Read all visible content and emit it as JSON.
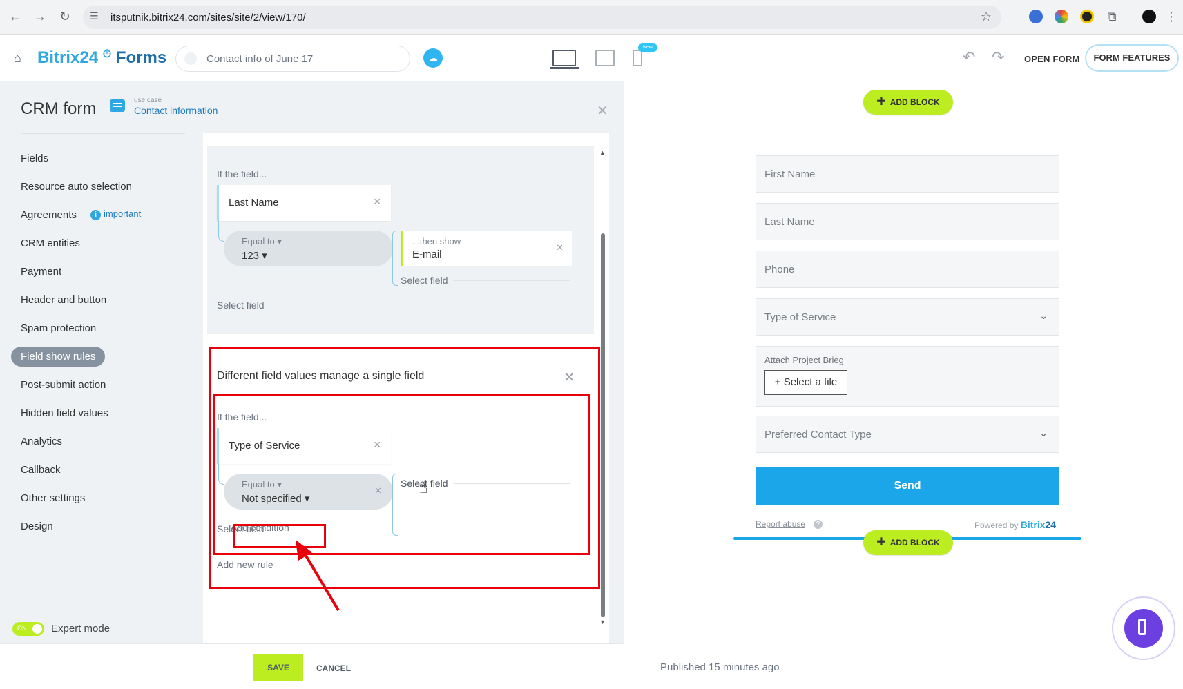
{
  "browser": {
    "url": "itsputnik.bitrix24.com/sites/site/2/view/170/"
  },
  "header": {
    "brand_main": "Bitrix24",
    "brand_sub": "Forms",
    "form_title": "Contact info of June 17",
    "new_badge": "New",
    "open_form": "OPEN FORM",
    "form_features": "FORM FEATURES"
  },
  "panel": {
    "title": "CRM form",
    "usecase_label": "use case",
    "usecase_link": "Contact information",
    "menu": [
      "Fields",
      "Resource auto selection",
      "Agreements",
      "CRM entities",
      "Payment",
      "Header and button",
      "Spam protection",
      "Field show rules",
      "Post-submit action",
      "Hidden field values",
      "Analytics",
      "Callback",
      "Other settings",
      "Design"
    ],
    "active_menu": "Field show rules",
    "important": "important",
    "expert_mode": "Expert mode",
    "toggle_on": "ON"
  },
  "rules": {
    "rule1": {
      "if_label": "If the field...",
      "field": "Last Name",
      "op": "Equal to",
      "value": "123",
      "then_label": "...then show",
      "then_field": "E-mail",
      "select_field_inner": "Select field",
      "select_field": "Select field"
    },
    "rule2": {
      "title": "Different field values manage a single field",
      "if_label": "If the field...",
      "field": "Type of Service",
      "op": "Equal to",
      "value": "Not specified",
      "then_select": "Select field",
      "add_condition": "Add condition",
      "select_field": "Select field"
    },
    "add_new_rule": "Add new rule"
  },
  "footer": {
    "save": "SAVE",
    "cancel": "CANCEL"
  },
  "preview": {
    "add_block": "ADD BLOCK",
    "fields": [
      "First Name",
      "Last Name",
      "Phone",
      "Type of Service"
    ],
    "file_label": "Attach Project Brieg",
    "file_button": "Select a file",
    "preferred": "Preferred Contact Type",
    "send": "Send",
    "report": "Report abuse",
    "powered_by": "Powered by",
    "powered_brand": "Bitrix",
    "powered_num": "24",
    "published": "Published 15 minutes ago"
  },
  "colors": {
    "accent_green": "#bbed21",
    "accent_blue": "#1aa6e8",
    "highlight_red": "#e8000b"
  }
}
